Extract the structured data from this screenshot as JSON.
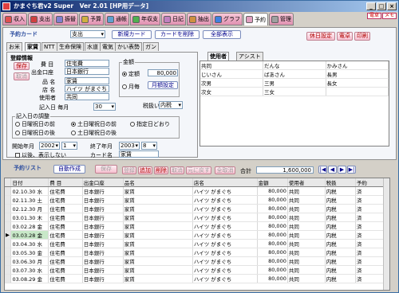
{
  "title": "かまぐち君v2 Super　Ver 2.01 [HP用データ]",
  "window_buttons": [
    "_",
    "□",
    "×"
  ],
  "main_tabs": [
    {
      "label": "収入",
      "color": "#e05050"
    },
    {
      "label": "支出",
      "color": "#d04040"
    },
    {
      "label": "振替",
      "color": "#8080d0"
    },
    {
      "label": "予算",
      "color": "#d0b040"
    },
    {
      "label": "通帳",
      "color": "#60a0d0"
    },
    {
      "label": "年収支",
      "color": "#50b050"
    },
    {
      "label": "日記",
      "color": "#c080c0"
    },
    {
      "label": "抽出",
      "color": "#d09040"
    },
    {
      "label": "グラフ",
      "color": "#4080e0"
    },
    {
      "label": "予約",
      "color": "#e0a0c0"
    },
    {
      "label": "管理",
      "color": "#a0a0a0"
    }
  ],
  "top_right": [
    "電卓",
    "メモ"
  ],
  "card": {
    "section_title": "予約カード",
    "type_select": "支出",
    "new_button": "新規カード",
    "delete_button": "カードを削除",
    "show_all_button": "全部表示",
    "subtabs": [
      "お米",
      "家賃",
      "NTT",
      "生命保険",
      "水道",
      "電気",
      "かい表勢",
      "ガン"
    ],
    "reg_info_label": "登録情報",
    "save_button": "保存",
    "cancel_button": "取消",
    "fields": {
      "expense_label": "費 目",
      "expense_value": "住宅費",
      "account_label": "出金口座",
      "account_value": "日本銀行",
      "item_label": "品 名",
      "item_value": "家賃",
      "shop_label": "店 名",
      "shop_value": "ハイツ がまぐち",
      "user_label": "使用者",
      "user_value": "共同",
      "entry_day_label": "記入日 毎月",
      "entry_day_value": "30",
      "amount_group": "金額",
      "fixed_label": "定額",
      "fixed_value": "80,000",
      "monthly_label": "月毎",
      "monthly_button": "月額設定",
      "tax_label": "税扱い",
      "tax_value": "内税"
    },
    "adjust_group": "記入日の調整",
    "adjust_options": [
      "日曜祝日の前",
      "土日曜祝日の前",
      "指定日どおり",
      "日曜祝日の後",
      "土日曜祝日の後"
    ],
    "start_label": "開始年月",
    "start_year": "2002",
    "start_month": "1",
    "end_label": "終了年月",
    "end_year": "2003",
    "end_month": "8",
    "hide_label": "以後、表示しない",
    "card_name_label": "カード名",
    "card_name_value": "家賃"
  },
  "right_buttons": [
    "休日設定",
    "電卓",
    "印刷"
  ],
  "user_tabs": [
    "使用者",
    "アシスト"
  ],
  "user_grid": [
    [
      "共同",
      "だんな",
      "かみさん"
    ],
    [
      "じいさん",
      "ばあさん",
      "長男"
    ],
    [
      "次男",
      "三男",
      "長女"
    ],
    [
      "次女",
      "三女",
      ""
    ]
  ],
  "list": {
    "section_title": "予約リスト",
    "auto_button": "自動作成",
    "actions": [
      "保存",
      "登録",
      "追加",
      "削除",
      "取消",
      "元に戻す",
      "全取消"
    ],
    "total_label": "合計",
    "total_value": "1,600,000",
    "nav": [
      "|◀",
      "◀",
      "▶",
      "▶|"
    ],
    "columns": [
      "日付",
      "費 目",
      "出金口座",
      "品名",
      "店名",
      "金額",
      "使用者",
      "税扱",
      "予約"
    ],
    "rows": [
      [
        "02.10.30 水",
        "住宅費",
        "日本銀行",
        "家賃",
        "ハイツ がまぐち",
        "80,000",
        "共同",
        "内税",
        "済"
      ],
      [
        "02.11.30 土",
        "住宅費",
        "日本銀行",
        "家賃",
        "ハイツ がまぐち",
        "80,000",
        "共同",
        "内税",
        "済"
      ],
      [
        "02.12.30 月",
        "住宅費",
        "日本銀行",
        "家賃",
        "ハイツ がまぐち",
        "80,000",
        "共同",
        "内税",
        "済"
      ],
      [
        "03.01.30 木",
        "住宅費",
        "日本銀行",
        "家賃",
        "ハイツ がまぐち",
        "80,000",
        "共同",
        "内税",
        "済"
      ],
      [
        "03.02.28 金",
        "住宅費",
        "日本銀行",
        "家賃",
        "ハイツ がまぐち",
        "80,000",
        "共同",
        "内税",
        "済"
      ],
      [
        "03.03.28 金",
        "住宅費",
        "日本銀行",
        "家賃",
        "ハイツ がまぐち",
        "80,000",
        "共同",
        "内税",
        "済"
      ],
      [
        "03.04.30 水",
        "住宅費",
        "日本銀行",
        "家賃",
        "ハイツ がまぐち",
        "80,000",
        "共同",
        "内税",
        "済"
      ],
      [
        "03.05.30 金",
        "住宅費",
        "日本銀行",
        "家賃",
        "ハイツ がまぐち",
        "80,000",
        "共同",
        "内税",
        "済"
      ],
      [
        "03.06.30 月",
        "住宅費",
        "日本銀行",
        "家賃",
        "ハイツ がまぐち",
        "80,000",
        "共同",
        "内税",
        "済"
      ],
      [
        "03.07.30 水",
        "住宅費",
        "日本銀行",
        "家賃",
        "ハイツ がまぐち",
        "80,000",
        "共同",
        "内税",
        "済"
      ],
      [
        "03.08.29 金",
        "住宅費",
        "日本銀行",
        "家賃",
        "ハイツ がまぐち",
        "80,000",
        "共同",
        "内税",
        "済"
      ]
    ],
    "selected_row": 5
  }
}
